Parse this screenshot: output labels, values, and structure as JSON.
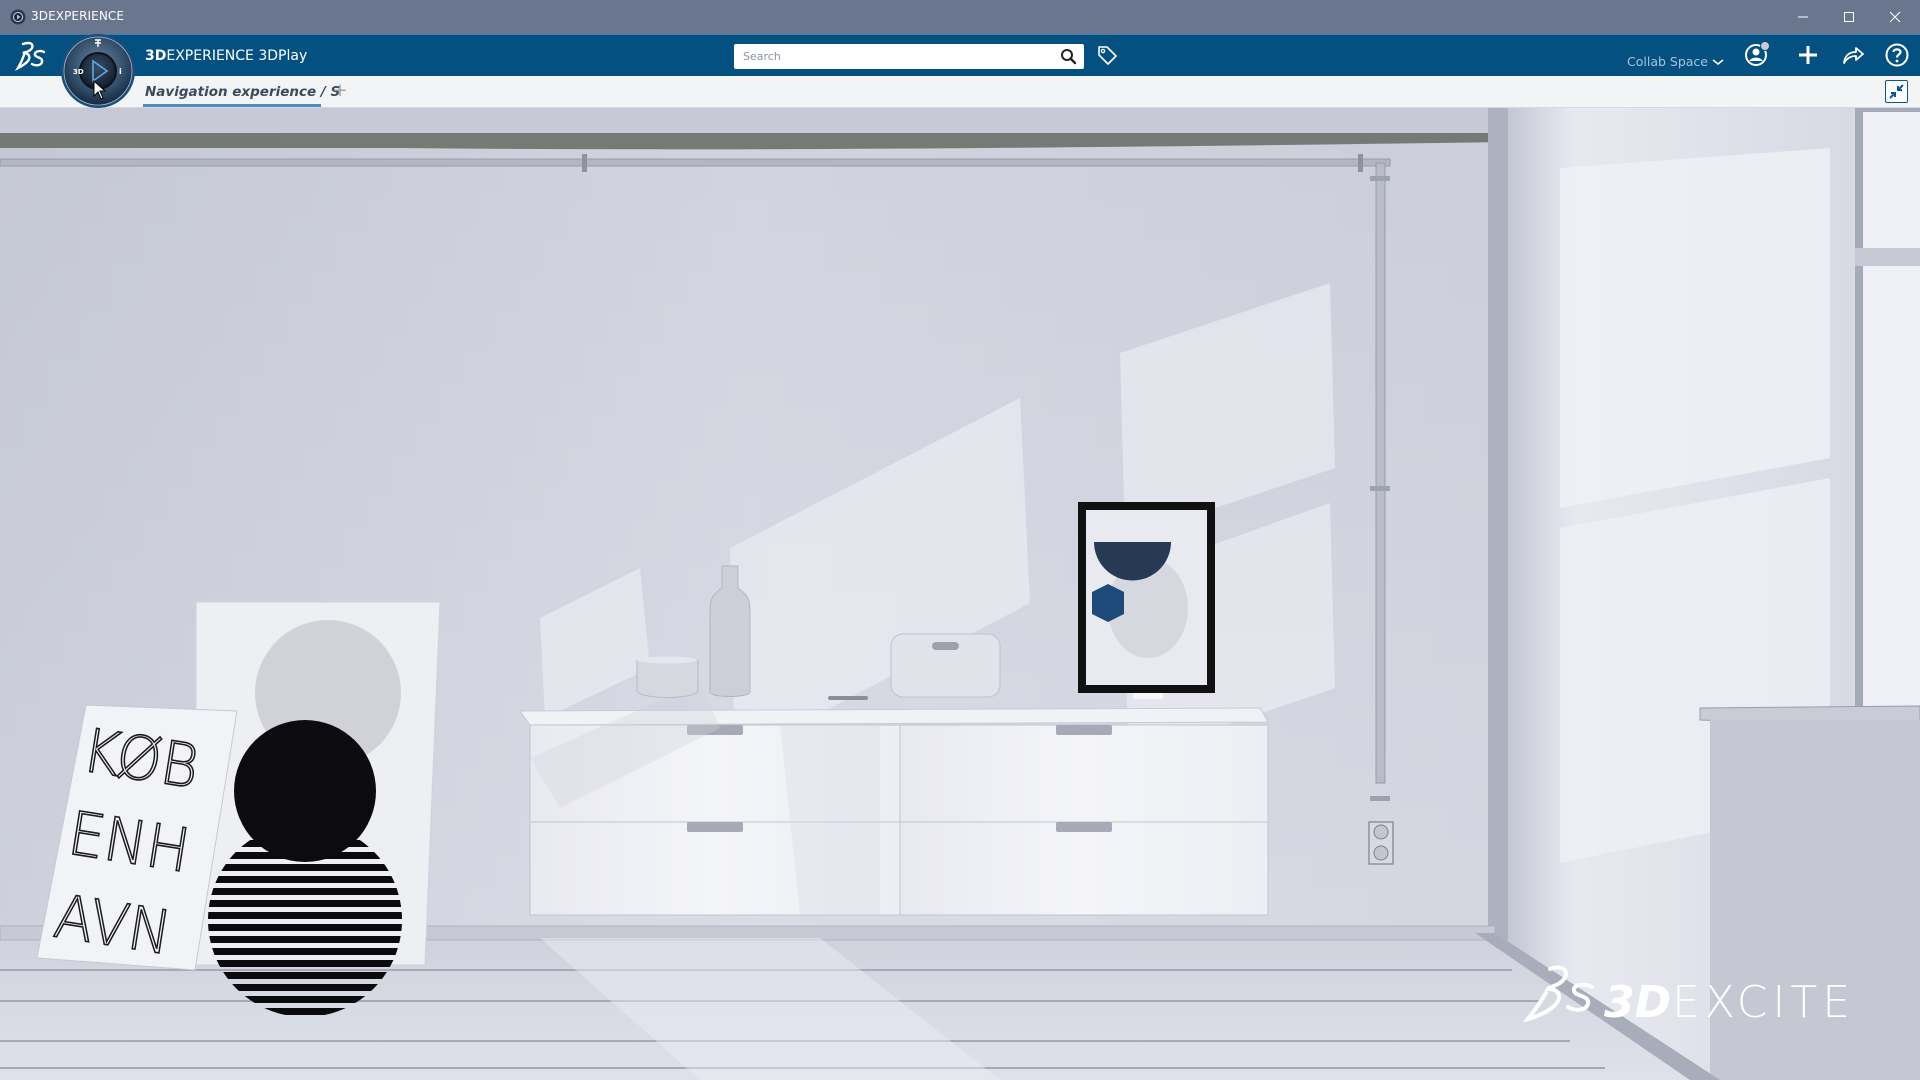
{
  "window": {
    "title": "3DEXPERIENCE",
    "controls": [
      "minimize",
      "maximize",
      "close"
    ]
  },
  "header": {
    "brand_bold": "3D",
    "brand_rest": "EXPERIENCE 3DPlay",
    "search": {
      "value": "",
      "placeholder": "Search"
    },
    "collab_space": "Collab Space",
    "icons": [
      "user-profile-icon",
      "add-icon",
      "share-icon",
      "help-icon",
      "tag-icon",
      "search-icon"
    ]
  },
  "compass": {
    "labels": {
      "left": "3D",
      "right": "i",
      "top": "ꝩ"
    }
  },
  "tabs": {
    "active_label": "Navigation experience / S",
    "add_label": "+"
  },
  "viewport": {
    "scene": "Interior room render: white wall-mounted dresser with bowl, bottle, speaker and framed abstract print; leaning posters on floor; window at right",
    "poster_text": [
      "KØB",
      "ENH",
      "AVN"
    ],
    "watermark": {
      "bold": "3D",
      "rest": "EXCITE"
    }
  },
  "colors": {
    "titlebar": "#6a768d",
    "header": "#045181",
    "tab_underline": "#4f8bbd",
    "tabbar": "#f3f4f6"
  }
}
